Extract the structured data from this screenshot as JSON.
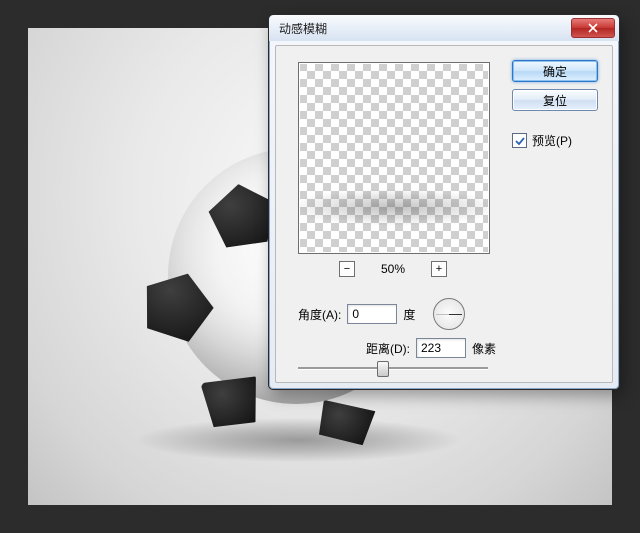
{
  "dialog": {
    "title": "动感模糊",
    "ok_label": "确定",
    "reset_label": "复位",
    "preview_label": "预览(P)",
    "preview_checked": true,
    "zoom": {
      "minus": "−",
      "plus": "+",
      "percent": "50%"
    },
    "angle": {
      "label": "角度(A):",
      "value": "0",
      "unit": "度"
    },
    "distance": {
      "label": "距离(D):",
      "value": "223",
      "unit": "像素",
      "slider_pct": 44
    }
  }
}
